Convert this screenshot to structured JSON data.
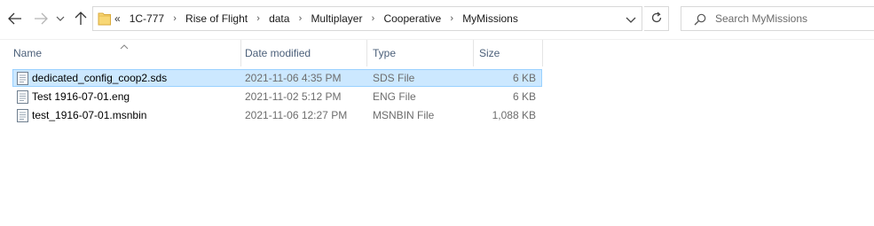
{
  "address": {
    "overflow": "«",
    "crumbs": [
      "1C-777",
      "Rise of Flight",
      "data",
      "Multiplayer",
      "Cooperative",
      "MyMissions"
    ]
  },
  "search": {
    "placeholder": "Search MyMissions"
  },
  "columns": {
    "name": "Name",
    "date": "Date modified",
    "type": "Type",
    "size": "Size"
  },
  "files": [
    {
      "name": "dedicated_config_coop2.sds",
      "date": "2021-11-06 4:35 PM",
      "type": "SDS File",
      "size": "6 KB",
      "selected": true
    },
    {
      "name": "Test 1916-07-01.eng",
      "date": "2021-11-02 5:12 PM",
      "type": "ENG File",
      "size": "6 KB",
      "selected": false
    },
    {
      "name": "test_1916-07-01.msnbin",
      "date": "2021-11-06 12:27 PM",
      "type": "MSNBIN File",
      "size": "1,088 KB",
      "selected": false
    }
  ],
  "colors": {
    "selection_fill": "#cce8ff",
    "selection_border": "#99d1ff",
    "header_text": "#4c607a",
    "folder_yellow": "#f8d775"
  }
}
